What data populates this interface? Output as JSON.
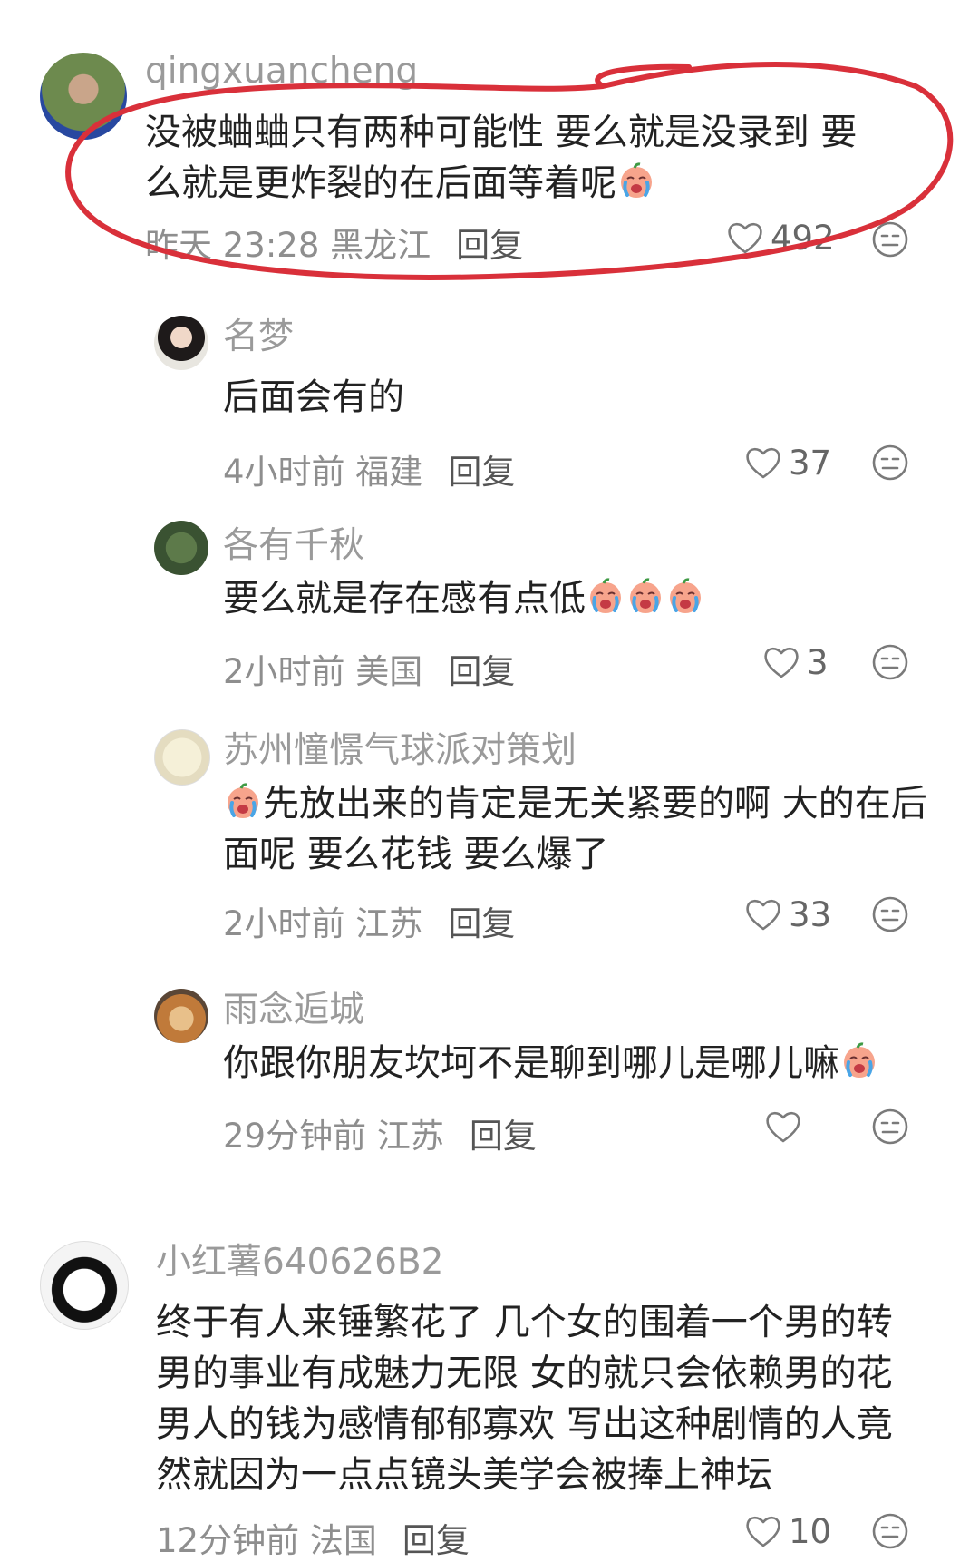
{
  "comments": [
    {
      "author": "qingxuancheng",
      "text_before": "没被蛐蛐只有两种可能性 要么就是没录到 要么就是更炸裂的在后面等着呢",
      "emoji": "crying-face-emoji",
      "meta": "昨天 23:28 黑龙江",
      "reply_label": "回复",
      "likes": "492",
      "replies": [
        {
          "author": "名梦",
          "text": "后面会有的",
          "meta": "4小时前 福建",
          "reply_label": "回复",
          "likes": "37"
        },
        {
          "author": "各有千秋",
          "text": "要么就是存在感有点低",
          "emoji_count": 3,
          "meta": "2小时前 美国",
          "reply_label": "回复",
          "likes": "3"
        },
        {
          "author": "苏州憧憬气球派对策划",
          "text": "先放出来的肯定是无关紧要的啊 大的在后面呢 要么花钱 要么爆了",
          "meta": "2小时前 江苏",
          "reply_label": "回复",
          "likes": "33"
        },
        {
          "author": "雨念逅城",
          "text": "你跟你朋友坎坷不是聊到哪儿是哪儿嘛",
          "meta": "29分钟前 江苏",
          "reply_label": "回复",
          "likes": ""
        }
      ]
    },
    {
      "author": "小红薯640626B2",
      "text": "终于有人来锤繁花了 几个女的围着一个男的转 男的事业有成魅力无限 女的就只会依赖男的花男人的钱为感情郁郁寡欢 写出这种剧情的人竟然就因为一点点镜头美学会被捧上神坛",
      "meta": "12分钟前 法国",
      "reply_label": "回复",
      "likes": "10"
    }
  ],
  "colors": {
    "annotation": "#d9303a",
    "muted_text": "#9a9a9a",
    "body_text": "#222222"
  },
  "icons": [
    "heart-outline-icon",
    "dislike-face-icon",
    "crying-face-emoji"
  ]
}
